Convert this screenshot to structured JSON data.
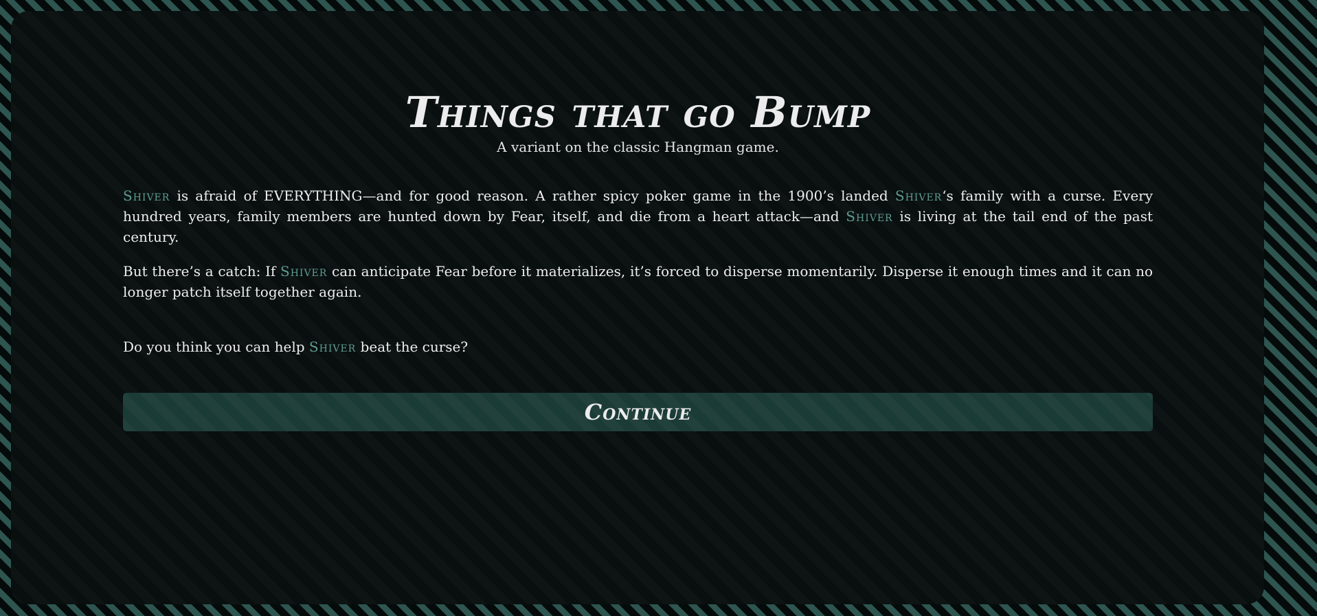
{
  "game": {
    "title": "Things that go Bump",
    "subtitle": "A variant on the classic Hangman game.",
    "character_name": "Shiver",
    "intro": {
      "p1_a": "is afraid of EVERYTHING—and for good reason. A rather spicy poker game in the 1900’s landed",
      "p1_b": "‘s family with a curse. Every hundred years, family members are hunted down by Fear, itself, and die from a heart attack—and",
      "p1_c": "is living at the tail end of the past century.",
      "p2_a": "But there’s a catch: If",
      "p2_b": "can anticipate Fear before it materializes, it’s forced to disperse momentarily. Disperse it enough times and it can no longer patch itself together again.",
      "p3_a": "Do you think you can help",
      "p3_b": "beat the curse?"
    },
    "continue_label": "Continue"
  },
  "colors": {
    "border_stripe": "#2e5550",
    "panel_bg": "#080f0e",
    "accent_name": "#5f9c92",
    "button_bg": "#1b3b37",
    "text": "#eeeeee"
  }
}
